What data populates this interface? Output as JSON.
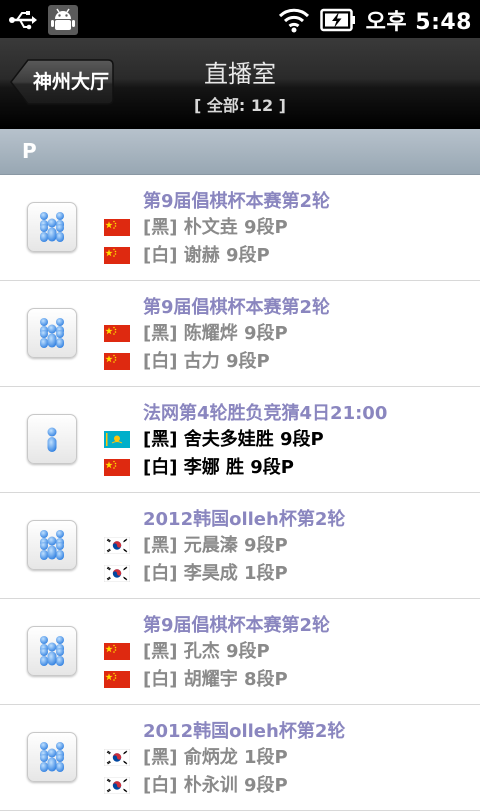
{
  "status_bar": {
    "time": "오후 5:48",
    "icons": [
      "usb-icon",
      "android-debug-icon",
      "wifi-icon",
      "battery-charging-icon"
    ]
  },
  "header": {
    "back_label": "神州大厅",
    "title": "直播室",
    "subtitle": "[ 全部: 12 ]"
  },
  "section": {
    "label": "P"
  },
  "colors": {
    "title_purple": "#8a86bf",
    "text_gray": "#8a8a8a",
    "section_bg": "#a9b6c1"
  },
  "games": [
    {
      "title": "第9届倡棋杯本赛第2轮",
      "avatar": "group-icon",
      "black": {
        "flag": "china-flag-icon",
        "text": "[黑] 朴文垚 9段P"
      },
      "white": {
        "flag": "china-flag-icon",
        "text": "[白] 谢赫 9段P"
      }
    },
    {
      "title": "第9届倡棋杯本赛第2轮",
      "avatar": "group-icon",
      "black": {
        "flag": "china-flag-icon",
        "text": "[黑] 陈耀烨 9段P"
      },
      "white": {
        "flag": "china-flag-icon",
        "text": "[白] 古力 9段P"
      }
    },
    {
      "title": "法网第4轮胜负竞猜4日21:00",
      "avatar": "single-person-icon",
      "live": true,
      "black": {
        "flag": "kazakhstan-flag-icon",
        "text": "[黑] 舍夫多娃胜 9段P"
      },
      "white": {
        "flag": "china-flag-icon",
        "text": "[白] 李娜 胜 9段P"
      }
    },
    {
      "title": "2012韩国olleh杯第2轮",
      "avatar": "group-icon",
      "black": {
        "flag": "korea-flag-icon",
        "text": "[黑] 元晨溱 9段P"
      },
      "white": {
        "flag": "korea-flag-icon",
        "text": "[白] 李昊成 1段P"
      }
    },
    {
      "title": "第9届倡棋杯本赛第2轮",
      "avatar": "group-icon",
      "black": {
        "flag": "china-flag-icon",
        "text": "[黑] 孔杰 9段P"
      },
      "white": {
        "flag": "china-flag-icon",
        "text": "[白] 胡耀宇 8段P"
      }
    },
    {
      "title": "2012韩国olleh杯第2轮",
      "avatar": "group-icon",
      "black": {
        "flag": "korea-flag-icon",
        "text": "[黑] 俞炳龙 1段P"
      },
      "white": {
        "flag": "korea-flag-icon",
        "text": "[白] 朴永训 9段P"
      }
    }
  ]
}
